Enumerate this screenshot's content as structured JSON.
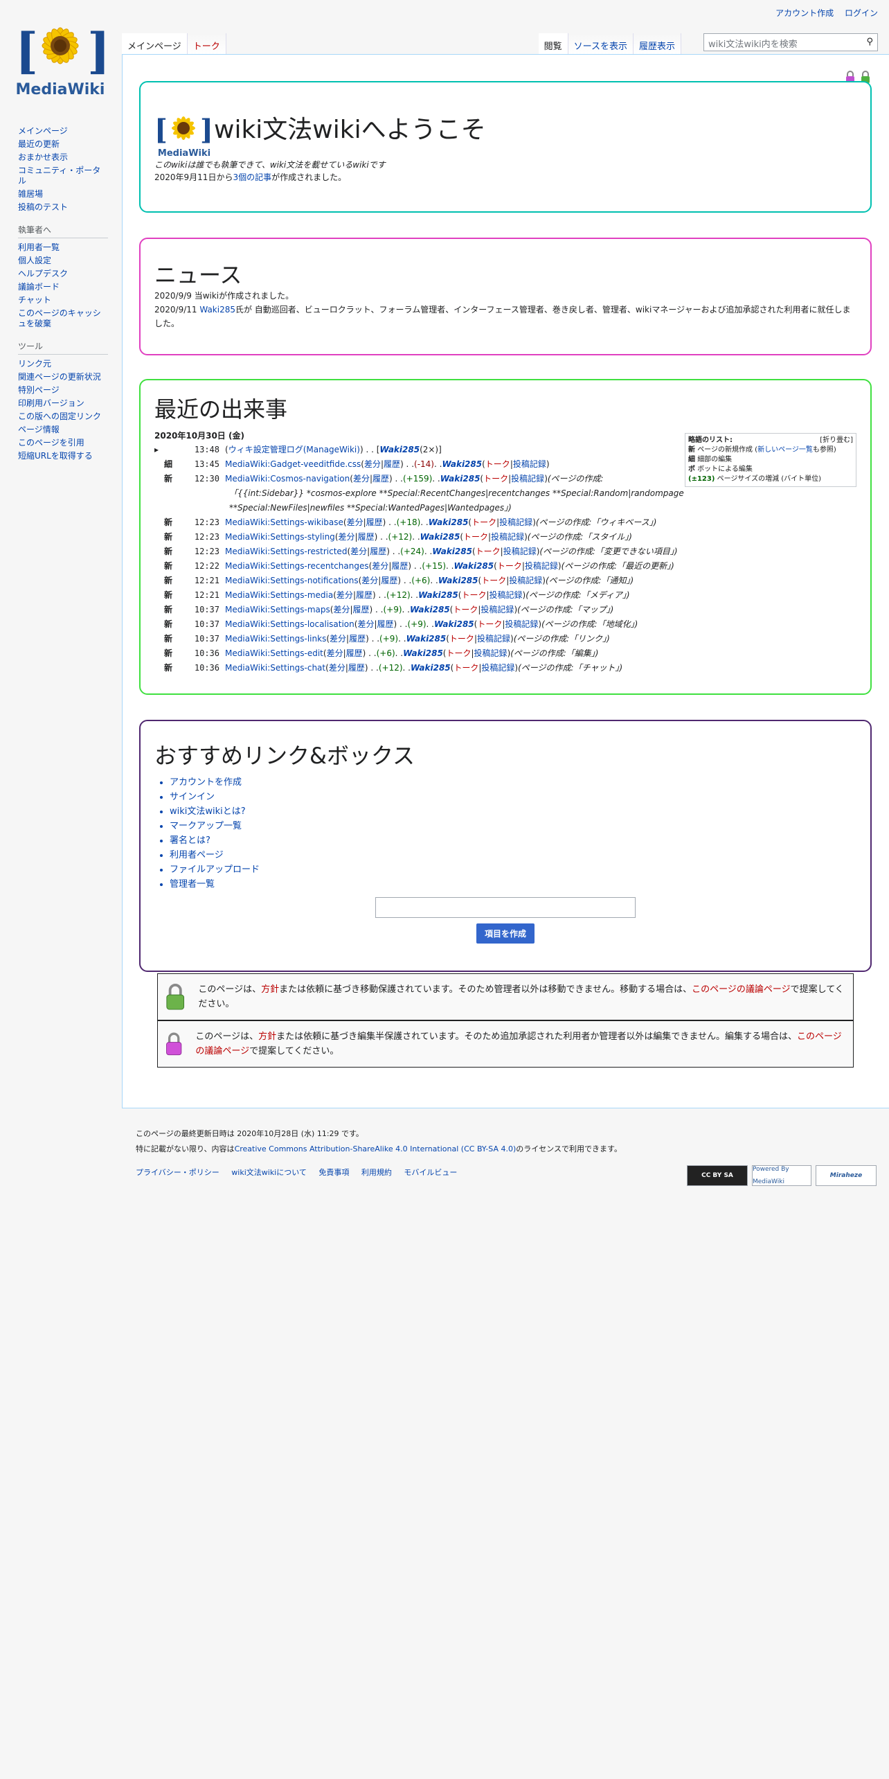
{
  "personal": {
    "create_account": "アカウント作成",
    "login": "ログイン"
  },
  "logo": {
    "text": "MediaWiki"
  },
  "sidebar": {
    "nav": [
      "メインページ",
      "最近の更新",
      "おまかせ表示",
      "コミュニティ・ポータル",
      "雑居場",
      "投稿のテスト"
    ],
    "editor_title": "執筆者へ",
    "editor": [
      "利用者一覧",
      "個人設定",
      "ヘルプデスク",
      "議論ボード",
      "チャット",
      "このページのキャッシュを破棄"
    ],
    "tools_title": "ツール",
    "tools": [
      "リンク元",
      "関連ページの更新状況",
      "特別ページ",
      "印刷用バージョン",
      "この版への固定リンク",
      "ページ情報",
      "このページを引用",
      "短縮URLを取得する"
    ]
  },
  "tabs": {
    "main": "メインページ",
    "talk": "トーク",
    "read": "閲覧",
    "source": "ソースを表示",
    "history": "履歴表示"
  },
  "search": {
    "placeholder": "wiki文法wiki内を検索"
  },
  "welcome": {
    "title": "wiki文法wikiへようこそ",
    "tagline": "このwikiは誰でも執筆できて、wiki文法を載せているwikiです",
    "created_pre": "2020年9月11日から",
    "created_link": "3個の記事",
    "created_post": "が作成されました。",
    "color": "#00c0b0"
  },
  "news": {
    "title": "ニュース",
    "line1": "2020/9/9 当wikiが作成されました。",
    "line2_pre": "2020/9/11 ",
    "line2_user": "Waki285",
    "line2_post": "氏が 自動巡回者、ビューロクラット、フォーラム管理者、インターフェース管理者、巻き戻し者、管理者、wikiマネージャーおよび追加承認された利用者に就任しました。",
    "color": "#e040c0"
  },
  "recent": {
    "title": "最近の出来事",
    "date": "2020年10月30日 (金)",
    "color": "#40e040",
    "first": {
      "time": "13:48",
      "open": "(",
      "log": "ウィキ設定管理ログ",
      "paren_link": "(ManageWiki)",
      "mid": ") . . [",
      "user": "Waki285",
      "count": " (2×)]"
    },
    "rows": [
      {
        "flag": "細",
        "time": "13:45",
        "page": "MediaWiki:Gadget-veeditfide.css",
        "diff": "差分",
        "hist": "履歴",
        "bytes": "(-14)",
        "sign": "neg",
        "user": "Waki285",
        "talk": "トーク",
        "contribs": "投稿記録",
        "summary": ""
      },
      {
        "flag": "新",
        "time": "12:30",
        "page": "MediaWiki:Cosmos-navigation",
        "diff": "差分",
        "hist": "履歴",
        "bytes": "(+159)",
        "sign": "pos",
        "user": "Waki285",
        "talk": "トーク",
        "contribs": "投稿記録",
        "summary": "(ページの作成:",
        "summary2": "「{{int:Sidebar}} *cosmos-explore **Special:RecentChanges|recentchanges **Special:Random|randompage",
        "summary3": "**Special:NewFiles|newfiles **Special:WantedPages|Wantedpages」)"
      },
      {
        "flag": "新",
        "time": "12:23",
        "page": "MediaWiki:Settings-wikibase",
        "diff": "差分",
        "hist": "履歴",
        "bytes": "(+18)",
        "sign": "pos",
        "user": "Waki285",
        "talk": "トーク",
        "contribs": "投稿記録",
        "summary": "(ページの作成:「ウィキベース」)"
      },
      {
        "flag": "新",
        "time": "12:23",
        "page": "MediaWiki:Settings-styling",
        "diff": "差分",
        "hist": "履歴",
        "bytes": "(+12)",
        "sign": "pos",
        "user": "Waki285",
        "talk": "トーク",
        "contribs": "投稿記録",
        "summary": "(ページの作成:「スタイル」)"
      },
      {
        "flag": "新",
        "time": "12:23",
        "page": "MediaWiki:Settings-restricted",
        "diff": "差分",
        "hist": "履歴",
        "bytes": "(+24)",
        "sign": "pos",
        "user": "Waki285",
        "talk": "トーク",
        "contribs": "投稿記録",
        "summary": "(ページの作成:「変更できない項目」)"
      },
      {
        "flag": "新",
        "time": "12:22",
        "page": "MediaWiki:Settings-recentchanges",
        "diff": "差分",
        "hist": "履歴",
        "bytes": "(+15)",
        "sign": "pos",
        "user": "Waki285",
        "talk": "トーク",
        "contribs": "投稿記録",
        "summary": "(ページの作成:「最近の更新」)"
      },
      {
        "flag": "新",
        "time": "12:21",
        "page": "MediaWiki:Settings-notifications",
        "diff": "差分",
        "hist": "履歴",
        "bytes": "(+6)",
        "sign": "pos",
        "user": "Waki285",
        "talk": "トーク",
        "contribs": "投稿記録",
        "summary": "(ページの作成:「通知」)"
      },
      {
        "flag": "新",
        "time": "12:21",
        "page": "MediaWiki:Settings-media",
        "diff": "差分",
        "hist": "履歴",
        "bytes": "(+12)",
        "sign": "pos",
        "user": "Waki285",
        "talk": "トーク",
        "contribs": "投稿記録",
        "summary": "(ページの作成:「メディア」)"
      },
      {
        "flag": "新",
        "time": "10:37",
        "page": "MediaWiki:Settings-maps",
        "diff": "差分",
        "hist": "履歴",
        "bytes": "(+9)",
        "sign": "pos",
        "user": "Waki285",
        "talk": "トーク",
        "contribs": "投稿記録",
        "summary": "(ページの作成:「マップ」)"
      },
      {
        "flag": "新",
        "time": "10:37",
        "page": "MediaWiki:Settings-localisation",
        "diff": "差分",
        "hist": "履歴",
        "bytes": "(+9)",
        "sign": "pos",
        "user": "Waki285",
        "talk": "トーク",
        "contribs": "投稿記録",
        "summary": "(ページの作成:「地域化」)"
      },
      {
        "flag": "新",
        "time": "10:37",
        "page": "MediaWiki:Settings-links",
        "diff": "差分",
        "hist": "履歴",
        "bytes": "(+9)",
        "sign": "pos",
        "user": "Waki285",
        "talk": "トーク",
        "contribs": "投稿記録",
        "summary": "(ページの作成:「リンク」)"
      },
      {
        "flag": "新",
        "time": "10:36",
        "page": "MediaWiki:Settings-edit",
        "diff": "差分",
        "hist": "履歴",
        "bytes": "(+6)",
        "sign": "pos",
        "user": "Waki285",
        "talk": "トーク",
        "contribs": "投稿記録",
        "summary": "(ページの作成:「編集」)"
      },
      {
        "flag": "新",
        "time": "10:36",
        "page": "MediaWiki:Settings-chat",
        "diff": "差分",
        "hist": "履歴",
        "bytes": "(+12)",
        "sign": "pos",
        "user": "Waki285",
        "talk": "トーク",
        "contribs": "投稿記録",
        "summary": "(ページの作成:「チャット」)"
      }
    ],
    "legend": {
      "title": "略語のリスト:",
      "toggle": "[折り畳む]",
      "n_key": "新",
      "n_pre": "ページの新規作成 (",
      "n_link": "新しいページ一覧",
      "n_post": "も参照)",
      "m_key": "細",
      "m_text": "細部の編集",
      "b_key": "ボ",
      "b_text": "ボットによる編集",
      "s_key": "(±123)",
      "s_text": "ページサイズの増減 (バイト単位)"
    }
  },
  "links": {
    "title": "おすすめリンク&ボックス",
    "color": "#502870",
    "items": [
      {
        "label": "アカウントを作成",
        "red": false
      },
      {
        "label": "サインイン",
        "red": false
      },
      {
        "label": "wiki文法wikiとは?",
        "red": true
      },
      {
        "label": "マークアップ一覧",
        "red": false
      },
      {
        "label": "署名とは?",
        "red": false
      },
      {
        "label": "利用者ページ",
        "red": false
      },
      {
        "label": "ファイルアップロード",
        "red": false
      },
      {
        "label": "管理者一覧",
        "red": false
      }
    ],
    "button": "項目を作成"
  },
  "protect1": {
    "pre": "このページは、",
    "policy": "方針",
    "mid": "または依頼に基づき移動保護されています。そのため管理者以外は移動できません。移動する場合は、",
    "talk": "このページの議論ページ",
    "post": "で提案してください。"
  },
  "protect2": {
    "pre": "このページは、",
    "policy": "方針",
    "mid": "または依頼に基づき編集半保護されています。そのため追加承認された利用者か管理者以外は編集できません。編集する場合は、",
    "talk": "このページの議論ページ",
    "post": "で提案してください。"
  },
  "footer": {
    "lastmod": "このページの最終更新日時は 2020年10月28日 (水) 11:29 です。",
    "license_pre": "特に記載がない限り、内容は",
    "license_link": "Creative Commons Attribution-ShareAlike 4.0 International (CC BY-SA 4.0)",
    "license_post": "のライセンスで利用できます。",
    "links": [
      "プライバシー・ポリシー",
      "wiki文法wikiについて",
      "免責事項",
      "利用規約",
      "モバイルビュー"
    ],
    "badge_cc": "CC BY SA",
    "badge_mw": "Powered By MediaWiki",
    "badge_mh": "Miraheze"
  }
}
